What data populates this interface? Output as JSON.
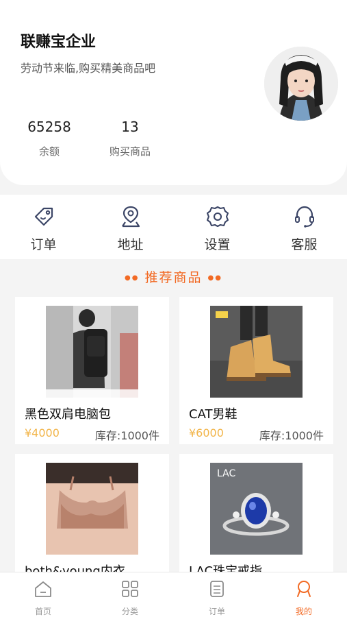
{
  "profile": {
    "company": "联赚宝企业",
    "slogan": "劳动节来临,购买精美商品吧",
    "balance_value": "65258",
    "balance_label": "余额",
    "purchases_value": "13",
    "purchases_label": "购买商品"
  },
  "menu": {
    "items": [
      {
        "label": "订单",
        "icon": "tag-icon"
      },
      {
        "label": "地址",
        "icon": "location-pin-icon"
      },
      {
        "label": "设置",
        "icon": "gear-icon"
      },
      {
        "label": "客服",
        "icon": "headset-icon"
      }
    ]
  },
  "section": {
    "title": "推荐商品"
  },
  "products": [
    {
      "name": "黑色双肩电脑包",
      "price": "¥4000",
      "stock": "库存:1000件"
    },
    {
      "name": "CAT男鞋",
      "price": "¥6000",
      "stock": "库存:1000件"
    },
    {
      "name": "both&young内衣",
      "price": "",
      "stock": ""
    },
    {
      "name": "LAC珠宝戒指",
      "price": "",
      "stock": ""
    }
  ],
  "tabbar": {
    "items": [
      {
        "label": "首页",
        "icon": "home-icon"
      },
      {
        "label": "分类",
        "icon": "grid-icon"
      },
      {
        "label": "订单",
        "icon": "order-list-icon"
      },
      {
        "label": "我的",
        "icon": "profile-icon"
      }
    ],
    "active_color": "#f26a24"
  },
  "colors": {
    "accent": "#f26a24",
    "price": "#f2b54a"
  }
}
